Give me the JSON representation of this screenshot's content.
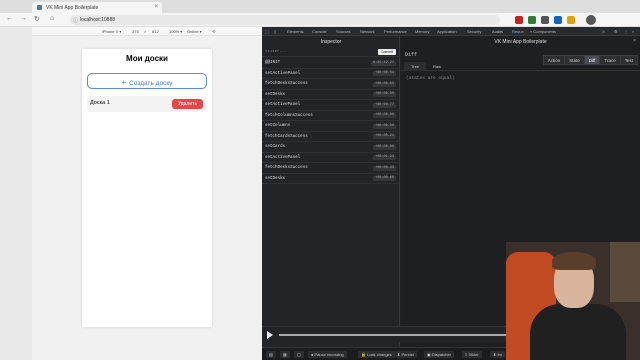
{
  "browser": {
    "tab_title": "VK Mini App Boilerplate",
    "url": "localhost:10888",
    "window_dot_colors": [
      "#ff5f57",
      "#febc2e",
      "#28c840"
    ],
    "extension_colors": [
      "#c5221f",
      "#2e7d32",
      "#555555",
      "#1565c0",
      "#e0a106"
    ]
  },
  "device_toolbar": {
    "device": "iPhone X ▾",
    "width": "375",
    "separator": "×",
    "height": "812",
    "zoom": "100% ▾",
    "network": "Online ▾"
  },
  "app": {
    "title": "Мои доски",
    "create_button": "Создать доску",
    "boards": [
      {
        "name": "Доска 1",
        "delete_label": "Удалить"
      }
    ],
    "accent_color": "#3f79c6",
    "danger_color": "#e64646"
  },
  "devtools_tabs": [
    "Elements",
    "Console",
    "Sources",
    "Network",
    "Performance",
    "Memory",
    "Application",
    "Security",
    "Audits",
    "Redux",
    "» Components"
  ],
  "inspector": {
    "title": "Inspector",
    "filter_placeholder": "filter...",
    "commit_label": "Commit",
    "actions": [
      {
        "name": "@@INIT",
        "time": "8:25:42.27"
      },
      {
        "name": "setActivePanel",
        "time": "+00:00.01"
      },
      {
        "name": "fetchDesksSuccess",
        "time": "+00:00.03"
      },
      {
        "name": "setDesks",
        "time": "+00:00.00"
      },
      {
        "name": "setActivePanel",
        "time": "+00:00.77"
      },
      {
        "name": "fetchColumnsSuccess",
        "time": "+00:00.00"
      },
      {
        "name": "setColumns",
        "time": "+00:00.00"
      },
      {
        "name": "fetchCardsSuccess",
        "time": "+00:00.21"
      },
      {
        "name": "setCards",
        "time": "+00:00.00"
      },
      {
        "name": "setActivePanel",
        "time": "+00:01.33"
      },
      {
        "name": "fetchDesksSuccess",
        "time": "+00:00.43"
      },
      {
        "name": "setDesks",
        "time": "+00:00.00"
      }
    ]
  },
  "redux_panel": {
    "title": "VK Mini App Boilerplate",
    "diff_label": "Diff",
    "mode_tabs": [
      "Action",
      "State",
      "Diff",
      "Trace",
      "Test"
    ],
    "active_mode": "Diff",
    "sub_tabs": [
      "Tree",
      "Raw"
    ],
    "active_sub_tab": "Tree",
    "empty_text": "(states are equal)",
    "slider_progress": 1.0
  },
  "bottom_tools": [
    "▤",
    "▦",
    "● Pause recording",
    "🔒 Lock changes",
    "⬇ Persist",
    "▣ Dispatcher",
    "≡ Slider",
    "⬇ Im"
  ]
}
